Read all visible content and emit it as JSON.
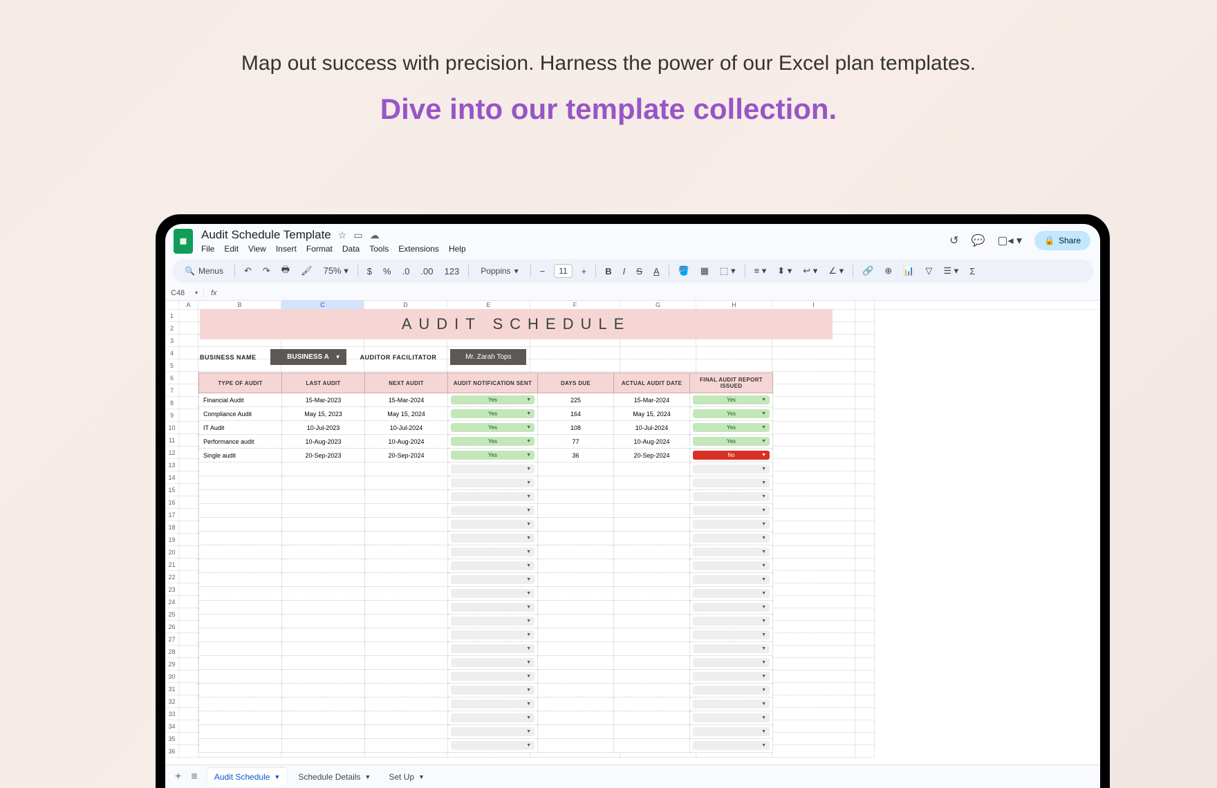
{
  "promo": {
    "line1": "Map out success with precision. Harness the power of our Excel plan templates.",
    "line2": "Dive into our template collection."
  },
  "doc": {
    "title": "Audit Schedule Template",
    "menus": [
      "File",
      "Edit",
      "View",
      "Insert",
      "Format",
      "Data",
      "Tools",
      "Extensions",
      "Help"
    ],
    "share_label": "Share"
  },
  "toolbar": {
    "menus_label": "Menus",
    "zoom": "75%",
    "currency": "$",
    "percent": "%",
    "fmt_dec": ".0",
    "fmt_inc": ".00",
    "fmt_123": "123",
    "font": "Poppins",
    "size": "11"
  },
  "fxbar": {
    "cellref": "C48",
    "fx": "fx"
  },
  "cols": [
    "",
    "A",
    "B",
    "C",
    "D",
    "E",
    "F",
    "G",
    "H",
    "I",
    ""
  ],
  "sheet": {
    "title": "AUDIT SCHEDULE",
    "business_name_label": "BUSINESS NAME",
    "business_name": "BUSINESS A",
    "facilitator_label": "AUDITOR FACILITATOR",
    "facilitator": "Mr. Zarah Tops",
    "headers": [
      "TYPE OF AUDIT",
      "LAST AUDIT",
      "NEXT AUDIT",
      "AUDIT NOTIFICATION SENT",
      "DAYS DUE",
      "ACTUAL AUDIT DATE",
      "FINAL AUDIT REPORT ISSUED"
    ],
    "rows": [
      {
        "type": "Financial Audit",
        "last": "15-Mar-2023",
        "next": "15-Mar-2024",
        "sent": "Yes",
        "days": "225",
        "actual": "15-Mar-2024",
        "final": "Yes",
        "final_cls": "yes"
      },
      {
        "type": "Compliance Audit",
        "last": "May 15, 2023",
        "next": "May 15, 2024",
        "sent": "Yes",
        "days": "164",
        "actual": "May 15, 2024",
        "final": "Yes",
        "final_cls": "yes"
      },
      {
        "type": "IT Audit",
        "last": "10-Jul-2023",
        "next": "10-Jul-2024",
        "sent": "Yes",
        "days": "108",
        "actual": "10-Jul-2024",
        "final": "Yes",
        "final_cls": "yes"
      },
      {
        "type": "Performance audit",
        "last": "10-Aug-2023",
        "next": "10-Aug-2024",
        "sent": "Yes",
        "days": "77",
        "actual": "10-Aug-2024",
        "final": "Yes",
        "final_cls": "yes"
      },
      {
        "type": "Single audit",
        "last": "20-Sep-2023",
        "next": "20-Sep-2024",
        "sent": "Yes",
        "days": "36",
        "actual": "20-Sep-2024",
        "final": "No",
        "final_cls": "no"
      }
    ],
    "empty_rows": 21
  },
  "tabs": {
    "items": [
      {
        "label": "Audit Schedule",
        "active": true
      },
      {
        "label": "Schedule Details",
        "active": false
      },
      {
        "label": "Set Up",
        "active": false
      }
    ]
  }
}
